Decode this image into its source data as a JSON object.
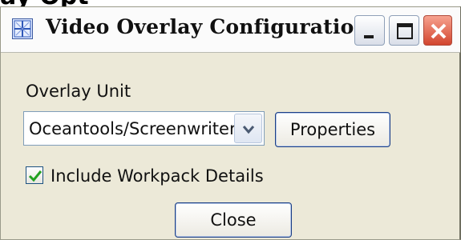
{
  "header_fragment": "ay Opt",
  "window": {
    "title": "Video Overlay Configuration",
    "app_icon": "app-grid-icon",
    "controls": {
      "minimize": "minimize-icon",
      "maximize": "maximize-icon",
      "close": "close-icon"
    }
  },
  "form": {
    "overlay_unit_label": "Overlay Unit",
    "overlay_unit_value": "Oceantools/Screenwriter",
    "dropdown_icon": "chevron-down-icon",
    "properties_button": "Properties",
    "include_workpack_checked": true,
    "include_workpack_label": "Include Workpack Details",
    "close_button": "Close"
  },
  "colors": {
    "dialog_bg": "#ece9d8",
    "close_button_red": "#d2452e",
    "check_green": "#21a121",
    "accent_border": "#1c3f86"
  }
}
